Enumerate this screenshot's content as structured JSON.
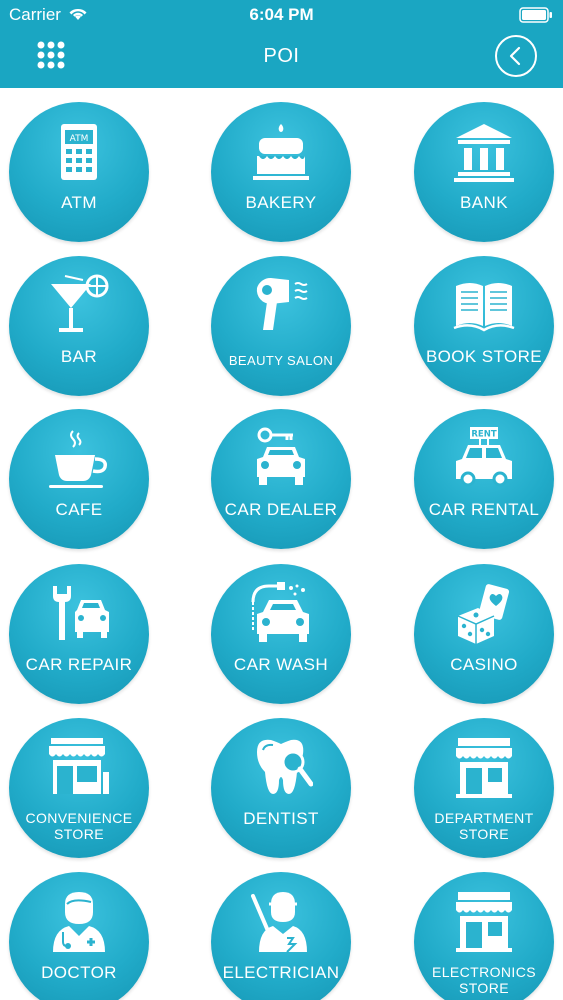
{
  "status_bar": {
    "carrier": "Carrier",
    "time": "6:04 PM"
  },
  "nav": {
    "title": "POI"
  },
  "colors": {
    "accent": "#1aa6c2",
    "circle": "#21abc9",
    "icon": "#ffffff"
  },
  "items": [
    {
      "label": "ATM",
      "icon": "atm-icon"
    },
    {
      "label": "BAKERY",
      "icon": "cake-icon"
    },
    {
      "label": "BANK",
      "icon": "bank-icon"
    },
    {
      "label": "BAR",
      "icon": "cocktail-icon"
    },
    {
      "label": "BEAUTY SALON",
      "icon": "hair-dryer-icon"
    },
    {
      "label": "BOOK STORE",
      "icon": "book-icon"
    },
    {
      "label": "CAFE",
      "icon": "coffee-cup-icon"
    },
    {
      "label": "CAR DEALER",
      "icon": "car-key-icon"
    },
    {
      "label": "CAR RENTAL",
      "icon": "rent-car-icon",
      "badge": "RENT"
    },
    {
      "label": "CAR REPAIR",
      "icon": "wrench-car-icon"
    },
    {
      "label": "CAR WASH",
      "icon": "car-wash-icon"
    },
    {
      "label": "CASINO",
      "icon": "dice-cards-icon"
    },
    {
      "label": "CONVENIENCE STORE",
      "line1": "CONVENIENCE",
      "line2": "STORE",
      "icon": "convenience-store-icon"
    },
    {
      "label": "DENTIST",
      "icon": "tooth-icon"
    },
    {
      "label": "DEPARTMENT STORE",
      "line1": "DEPARTMENT",
      "line2": "STORE",
      "icon": "department-store-icon"
    },
    {
      "label": "DOCTOR",
      "icon": "doctor-icon"
    },
    {
      "label": "ELECTRICIAN",
      "icon": "electrician-icon"
    },
    {
      "label": "ELECTRONICS STORE",
      "line1": "ELECTRONICS",
      "line2": "STORE",
      "icon": "electronics-store-icon"
    }
  ]
}
